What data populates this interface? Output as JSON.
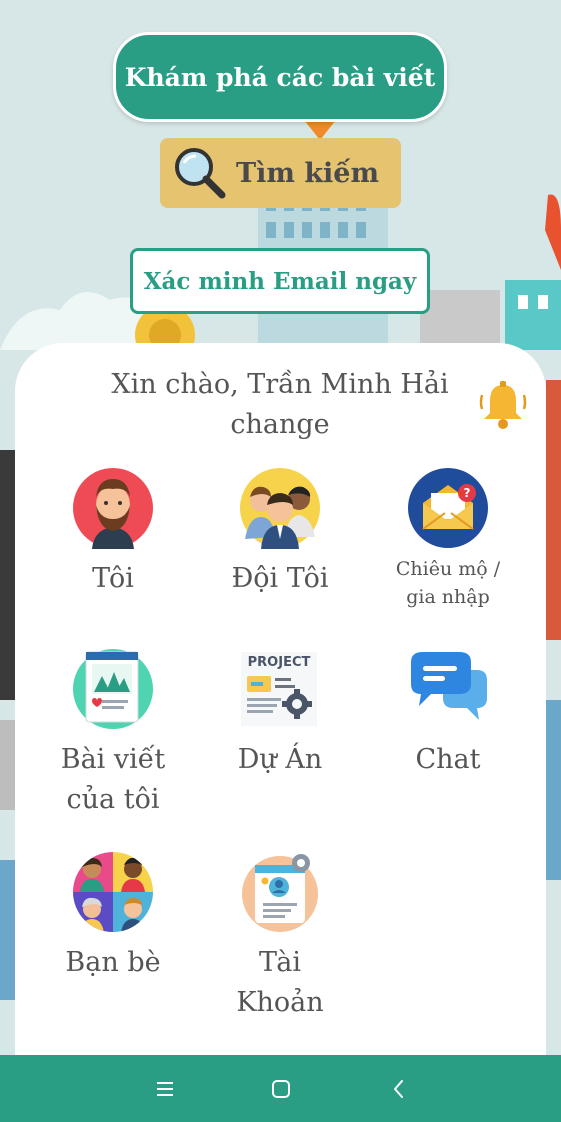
{
  "buttons": {
    "explore_label": "Khám phá các bài viết",
    "search_label": "Tìm kiếm",
    "verify_label": "Xác minh Email ngay"
  },
  "greeting": {
    "line1": "Xin chào, Trần Minh Hải",
    "line2": "change"
  },
  "menu": {
    "me": "Tôi",
    "my_team": "Đội Tôi",
    "recruit_join_line1": "Chiêu mộ /",
    "recruit_join_line2": "gia nhập",
    "my_posts_line1": "Bài viết",
    "my_posts_line2": "của tôi",
    "projects": "Dự Án",
    "chat": "Chat",
    "friends": "Bạn bè",
    "account_line1": "Tài",
    "account_line2": "Khoản"
  },
  "icons": {
    "search": "magnifier-icon",
    "bell": "bell-icon",
    "me": "bearded-man-avatar-icon",
    "my_team": "team-group-icon",
    "recruit_join": "envelope-question-icon",
    "my_posts": "photo-post-icon",
    "projects": "project-document-icon",
    "chat": "chat-bubbles-icon",
    "friends": "friends-grid-icon",
    "account": "account-profile-icon",
    "nav_menu": "menu-lines-icon",
    "nav_home": "square-home-icon",
    "nav_back": "back-chevron-icon"
  },
  "colors": {
    "primary": "#2a9d85",
    "search_bg": "#e6c36f",
    "text": "#555555"
  }
}
